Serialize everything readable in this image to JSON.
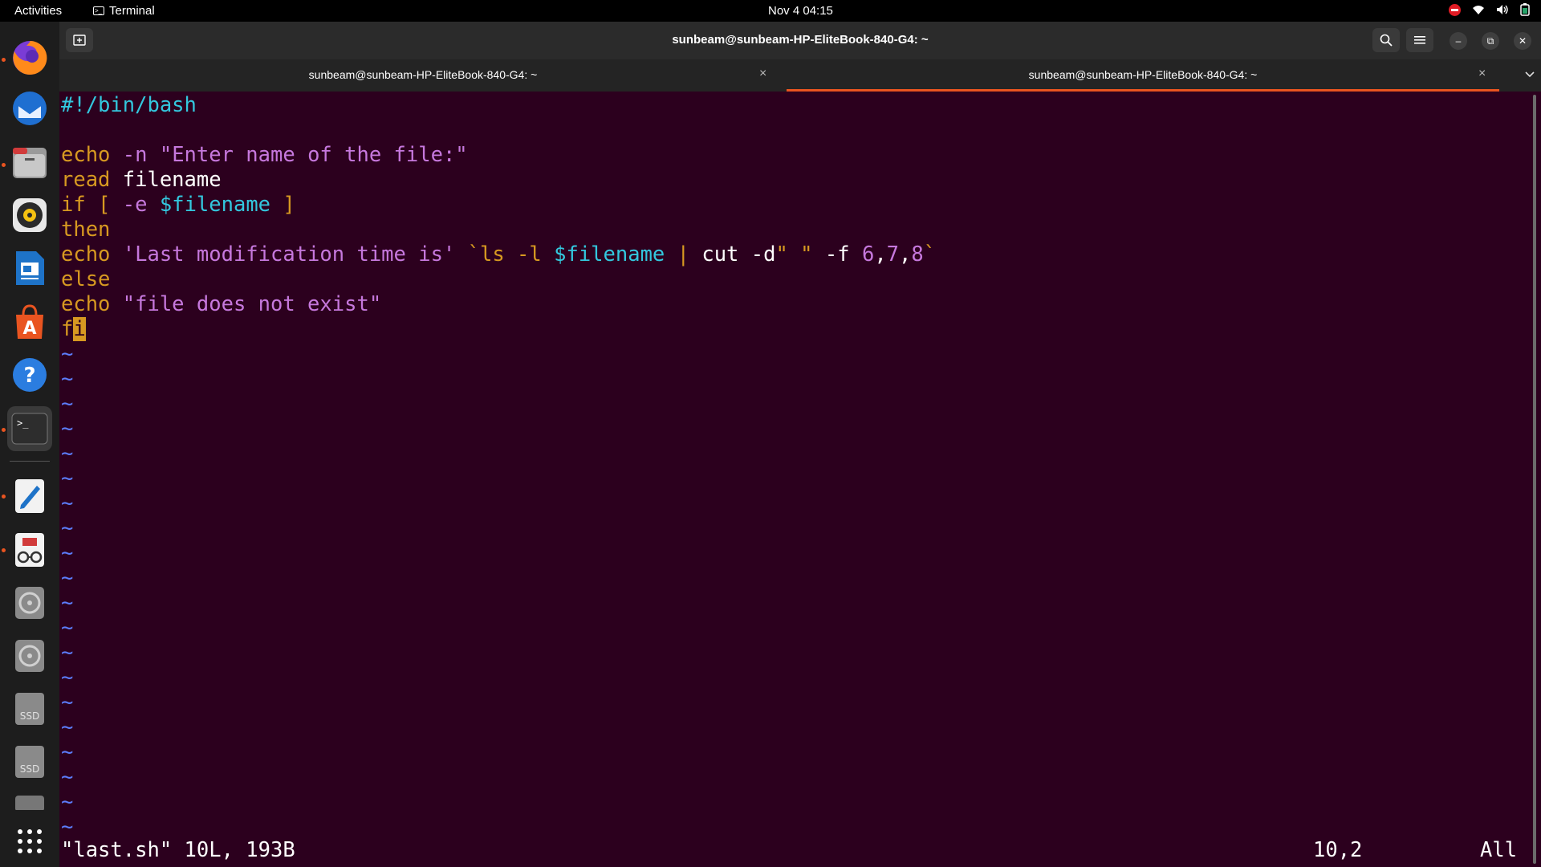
{
  "topbar": {
    "activities": "Activities",
    "app_name": "Terminal",
    "clock": "Nov 4  04:15"
  },
  "window": {
    "title": "sunbeam@sunbeam-HP-EliteBook-840-G4: ~",
    "tabs": [
      {
        "label": "sunbeam@sunbeam-HP-EliteBook-840-G4: ~",
        "active": false
      },
      {
        "label": "sunbeam@sunbeam-HP-EliteBook-840-G4: ~",
        "active": true
      }
    ]
  },
  "dock": {
    "items": [
      {
        "name": "firefox",
        "running": true
      },
      {
        "name": "thunderbird",
        "running": false
      },
      {
        "name": "files",
        "running": true
      },
      {
        "name": "rhythmbox",
        "running": false
      },
      {
        "name": "libreoffice-writer",
        "running": false
      },
      {
        "name": "app-center",
        "running": false
      },
      {
        "name": "help",
        "running": false
      },
      {
        "name": "terminal",
        "running": true,
        "active": true
      },
      {
        "name": "text-editor",
        "running": true
      },
      {
        "name": "document-viewer",
        "running": true
      },
      {
        "name": "disk",
        "running": false
      },
      {
        "name": "disk",
        "running": false
      },
      {
        "name": "ssd-drive",
        "label": "SSD"
      },
      {
        "name": "ssd-drive",
        "label": "SSD"
      },
      {
        "name": "drive"
      },
      {
        "name": "show-apps"
      }
    ]
  },
  "editor": {
    "shebang": "#!/bin/bash",
    "lines": {
      "l3_kw": "echo",
      "l3_opt": " -n ",
      "l3_str": "\"Enter name of the file:\"",
      "l4_kw": "read",
      "l4_rest": " filename",
      "l5_kw": "if",
      "l5_a": " [ ",
      "l5_opt": "-e",
      "l5_sp": " ",
      "l5_var": "$filename",
      "l5_b": " ]",
      "l6_kw": "then",
      "l7_kw": "echo",
      "l7_str": " 'Last modification time is' ",
      "l7_bt": "`ls -l ",
      "l7_var": "$filename",
      "l7_pipe": " | ",
      "l7_cut": "cut -d",
      "l7_q": "\" \"",
      "l7_f": " -f ",
      "l7_n1": "6",
      "l7_c1": ",",
      "l7_n2": "7",
      "l7_c2": ",",
      "l7_n3": "8",
      "l7_end": "`",
      "l8_kw": "else",
      "l9_kw": "echo",
      "l9_str": " \"file does not exist\"",
      "l10_f": "f",
      "l10_i": "i"
    },
    "tilde": "~",
    "status": {
      "file": "\"last.sh\" 10L, 193B",
      "position": "10,2",
      "scroll": "All"
    }
  }
}
